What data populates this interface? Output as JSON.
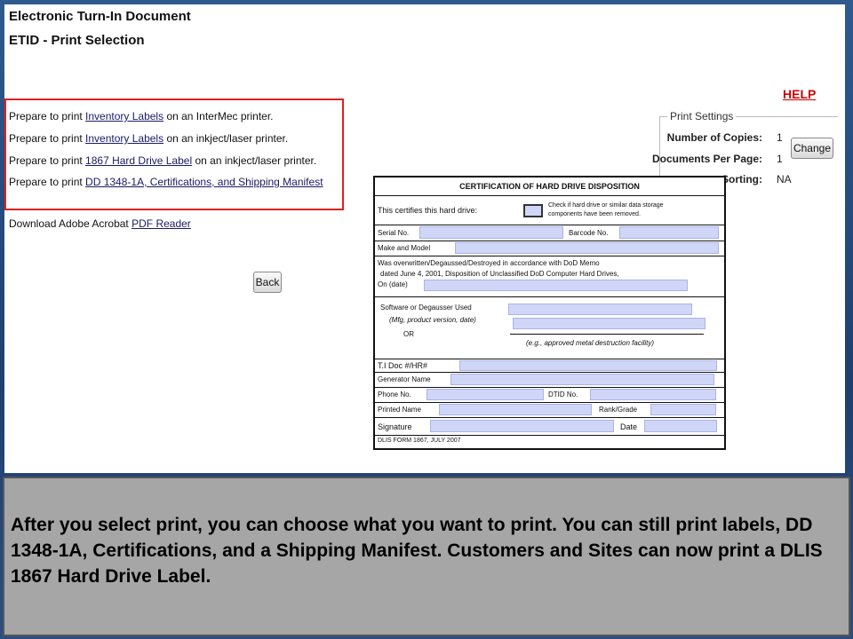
{
  "header": {
    "title": "Electronic Turn-In Document",
    "subtitle": "ETID - Print Selection"
  },
  "help_label": "HELP",
  "print_options": [
    {
      "prefix": "Prepare to print ",
      "link": "Inventory Labels",
      "suffix": " on an InterMec printer."
    },
    {
      "prefix": "Prepare to print ",
      "link": "Inventory Labels",
      "suffix": " on an inkject/laser printer."
    },
    {
      "prefix": "Prepare to print ",
      "link": "1867 Hard Drive Label",
      "suffix": " on an inkject/laser printer."
    },
    {
      "prefix": "Prepare to print ",
      "link": "DD 1348-1A, Certifications, and Shipping Manifest",
      "suffix": ""
    }
  ],
  "download": {
    "prefix": "Download Adobe Acrobat ",
    "link": "PDF Reader"
  },
  "back_label": "Back",
  "print_settings": {
    "legend": "Print Settings",
    "copies_label": "Number of Copies:",
    "copies_value": "1",
    "per_page_label": "Documents Per Page:",
    "per_page_value": "1",
    "sorting_label": "Sorting:",
    "sorting_value": "NA",
    "change_label": "Change"
  },
  "certificate": {
    "title": "CERTIFICATION OF HARD DRIVE DISPOSITION",
    "certifies": "This certifies this hard drive:",
    "check_note_1": "Check if hard drive or similar data storage",
    "check_note_2": "components have been removed.",
    "serial": "Serial No.",
    "barcode": "Barcode No.",
    "make_model": "Make and Model",
    "overwritten_1": "Was overwritten/Degaussed/Destroyed in accordance with DoD Memo",
    "overwritten_2": "dated June 4, 2001, Disposition of Unclassified DoD Computer Hard Drives,",
    "overwritten_3": "On (date)",
    "software": "Software or Degausser Used",
    "mfg": "(Mfg, product version, date)",
    "or": "OR",
    "approved": "(e.g., approved metal destruction facility)",
    "ti_doc": "T.I Doc #/HR#",
    "generator": "Generator Name",
    "phone": "Phone No.",
    "dtid": "DTID No.",
    "printed_name": "Printed Name",
    "rank": "Rank/Grade",
    "signature": "Signature",
    "date": "Date",
    "form": "DLIS FORM 1867, JULY 2007"
  },
  "caption": "After you select print, you can choose what you want to print.  You can still print labels, DD 1348-1A, Certifications, and a Shipping Manifest. Customers and Sites can now print a DLIS 1867 Hard Drive Label."
}
